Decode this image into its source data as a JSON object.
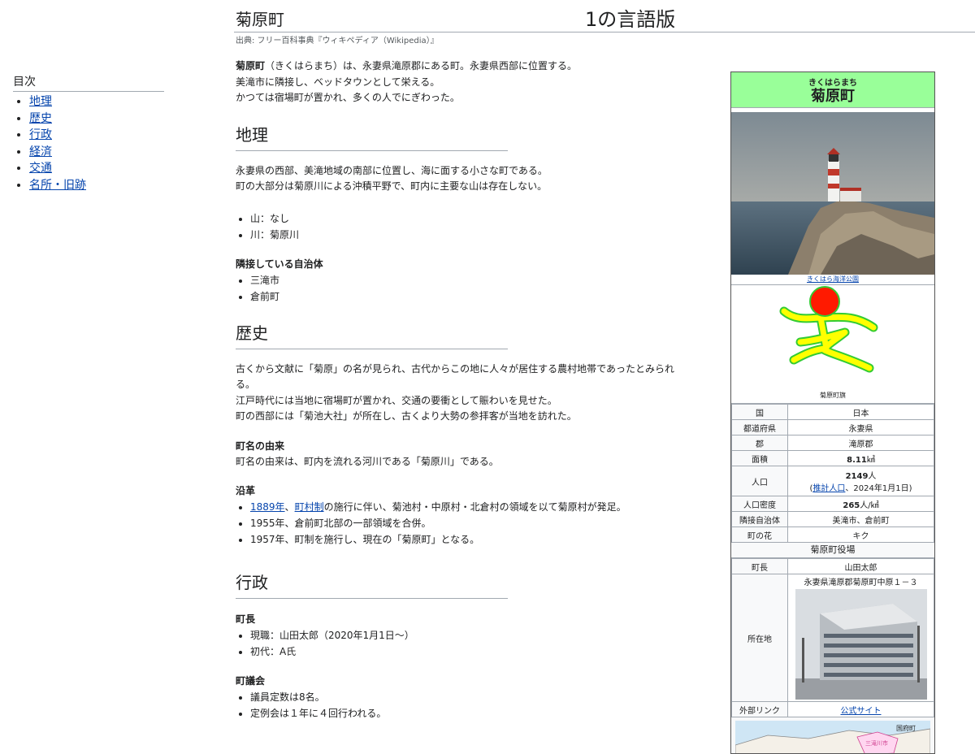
{
  "header": {
    "title": "菊原町",
    "lang_count": "1の言語版",
    "source": "出典: フリー百科事典『ウィキペディア（Wikipedia）』"
  },
  "toc": {
    "title": "目次",
    "items": [
      "地理",
      "歴史",
      "行政",
      "経済",
      "交通",
      "名所・旧跡"
    ]
  },
  "intro": {
    "name": "菊原町",
    "line1_rest": "（きくはらまち）は、永妻県滝原郡にある町。永妻県西部に位置する。",
    "line2": "美滝市に隣接し、ベッドタウンとして栄える。",
    "line3": "かつては宿場町が置かれ、多くの人でにぎわった。"
  },
  "geography": {
    "heading": "地理",
    "p1": "永妻県の西部、美滝地域の南部に位置し、海に面する小さな町である。",
    "p2": "町の大部分は菊原川による沖積平野で、町内に主要な山は存在しない。",
    "features": [
      "山：なし",
      "川：菊原川"
    ],
    "neighbors_heading": "隣接している自治体",
    "neighbors": [
      "三滝市",
      "倉前町"
    ]
  },
  "history": {
    "heading": "歴史",
    "p1": "古くから文献に「菊原」の名が見られ、古代からこの地に人々が居住する農村地帯であったとみられる。",
    "p2": "江戸時代には当地に宿場町が置かれ、交通の要衝として賑わいを見せた。",
    "p3": "町の西部には「菊池大社」が所在し、古くより大勢の参拝客が当地を訪れた。",
    "origin_heading": "町名の由来",
    "origin_text": "町名の由来は、町内を流れる河川である「菊原川」である。",
    "timeline_heading": "沿革",
    "t1_link1": "1889年",
    "t1_sep": "、",
    "t1_link2": "町村制",
    "t1_rest": "の施行に伴い、菊池村・中原村・北倉村の領域を以て菊原村が発足。",
    "t2": "1955年、倉前町北部の一部領域を合併。",
    "t3": "1957年、町制を施行し、現在の「菊原町」となる。"
  },
  "administration": {
    "heading": "行政",
    "mayor_heading": "町長",
    "mayors": [
      "現職：山田太郎（2020年1月1日～）",
      "初代：A氏"
    ],
    "council_heading": "町議会",
    "council": [
      "議員定数は8名。",
      "定例会は１年に４回行われる。"
    ]
  },
  "infobox": {
    "reading": "きくはらまち",
    "name": "菊原町",
    "photo_caption": "きくはら海洋公園",
    "flag_caption": "菊原町旗",
    "rows": [
      {
        "label": "国",
        "value": "日本"
      },
      {
        "label": "都道府県",
        "value": "永妻県"
      },
      {
        "label": "郡",
        "value": "滝原郡"
      }
    ],
    "area_label": "面積",
    "area_value": "8.11",
    "area_unit": "㎢",
    "population_label": "人口",
    "population_value": "2149",
    "population_unit": "人",
    "population_note_open": "(",
    "population_note_link": "推計人口",
    "population_note_rest": "、2024年1月1日)",
    "density_label": "人口密度",
    "density_value": "265",
    "density_unit": "人/㎢",
    "rows2": [
      {
        "label": "隣接自治体",
        "value": "美滝市、倉前町"
      },
      {
        "label": "町の花",
        "value": "キク"
      }
    ],
    "office_heading": "菊原町役場",
    "mayor_label": "町長",
    "mayor_value": "山田太郎",
    "address_label": "所在地",
    "address_value": "永妻県滝原郡菊原町中原１－３",
    "link_label": "外部リンク",
    "link_value": "公式サイト",
    "map_label_1": "国府町",
    "map_label_2": "三滝川市"
  },
  "colors": {
    "infobox_header": "#99ff99",
    "link": "#0645ad",
    "flag_red": "#ff1a00",
    "flag_yellow": "#ffff00",
    "flag_green": "#33cc33"
  }
}
